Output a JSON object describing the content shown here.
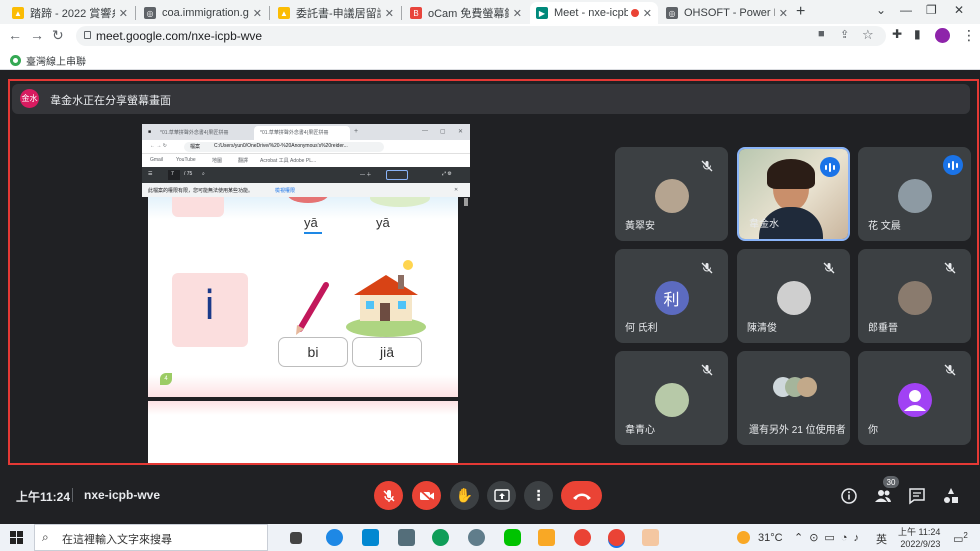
{
  "browser": {
    "tabs": [
      {
        "label": "踏蹄 - 2022 賞響糸訳",
        "color": "#1a73e8",
        "glyph": "▲"
      },
      {
        "label": "coa.immigration.gov",
        "color": "#5f6368",
        "glyph": "◎"
      },
      {
        "label": "委託書-申議居留證09",
        "color": "#1a73e8",
        "glyph": "▲"
      },
      {
        "label": "oCam 免費螢幕錄影",
        "color": "#e8453c",
        "glyph": "B"
      },
      {
        "label": "Meet - nxe-icpb",
        "color": "#00897b",
        "glyph": "▶"
      },
      {
        "label": "OHSOFT - Power PC",
        "color": "#5f6368",
        "glyph": "◎"
      }
    ],
    "url": "meet.google.com/nxe-icpb-wve",
    "bookmark": "臺灣線上串聯"
  },
  "presentation": {
    "presenter_initial": "金水",
    "banner": "韋金水正在分享螢幕畫面"
  },
  "shared_screen": {
    "tab1": "*01.草華拼聲外念書4(果匠拼冊",
    "tab2": "*01.草華拼聲外念書4(果匠拼冊",
    "path": "C:/Users/yun0/OneDrive/%20-%20Anonymous's%20reider...",
    "file_label": "檔案",
    "bookmarks": [
      "Gmail",
      "YouTube",
      "地圖",
      "翻譯",
      "Acrobat 工具 Adobe PL..."
    ],
    "page_num": "7",
    "page_total": "/ 75",
    "info": "此檔案的權限有限，您可能無法使用某些功能。",
    "info_link": "檢視權限",
    "syllables_top": [
      "yā",
      "yā"
    ],
    "letter": "i",
    "words": [
      "bi",
      "jiā"
    ],
    "page_number": "4"
  },
  "participants": [
    {
      "name": "黃翠安",
      "muted": true,
      "type": "photo",
      "color": "#b5a490"
    },
    {
      "name": "韋金水",
      "muted": false,
      "type": "video",
      "speaking": true
    },
    {
      "name": "花 文晨",
      "muted": false,
      "type": "photo",
      "color": "#8d9aa3",
      "talking": true
    },
    {
      "name": "何 氏利",
      "muted": true,
      "type": "letter",
      "letter": "利",
      "color": "#5c6bc0"
    },
    {
      "name": "陳清俊",
      "muted": true,
      "type": "photo",
      "color": "#cfcfcf"
    },
    {
      "name": "郎垂晉",
      "muted": true,
      "type": "photo",
      "color": "#8a7b6e"
    },
    {
      "name": "韋青心",
      "muted": true,
      "type": "photo",
      "color": "#b7c9a8"
    },
    {
      "name": "還有另外 21 位使用者",
      "muted": false,
      "type": "group"
    },
    {
      "name": "你",
      "muted": true,
      "type": "you",
      "color": "#a142f4"
    }
  ],
  "meeting": {
    "time": "上午11:24",
    "code": "nxe-icpb-wve",
    "people_count": "30"
  },
  "taskbar": {
    "search_placeholder": "在這裡輸入文字來搜尋",
    "temperature": "31°C",
    "lang": "英",
    "time": "上午 11:24",
    "date": "2022/9/23",
    "notif": "2"
  },
  "colors": {
    "accent": "#8ab4f8",
    "danger": "#ea4335",
    "tile": "#3c4043"
  }
}
